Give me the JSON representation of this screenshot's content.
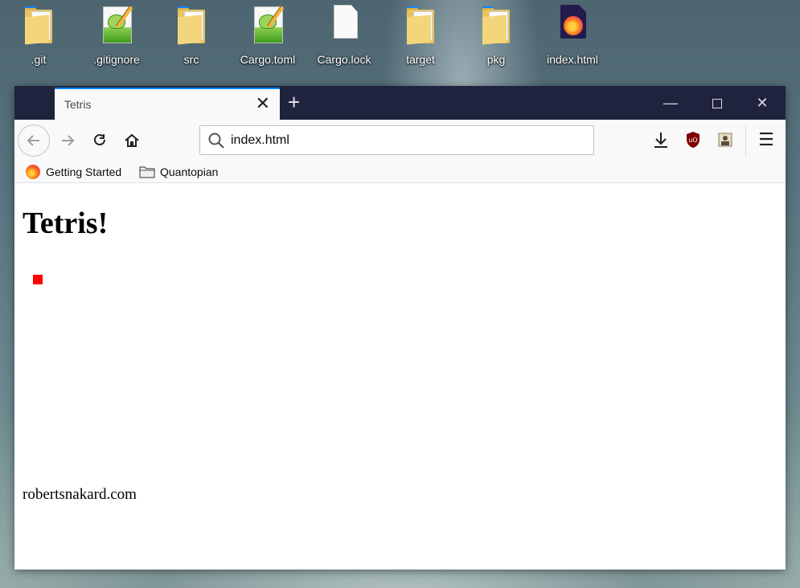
{
  "desktop": {
    "items": [
      {
        "label": ".git",
        "icon": "folder-icon"
      },
      {
        "label": ".gitignore",
        "icon": "notepadpp-file-icon"
      },
      {
        "label": "src",
        "icon": "folder-icon"
      },
      {
        "label": "Cargo.toml",
        "icon": "notepadpp-file-icon"
      },
      {
        "label": "Cargo.lock",
        "icon": "blank-file-icon"
      },
      {
        "label": "target",
        "icon": "folder-icon"
      },
      {
        "label": "pkg",
        "icon": "folder-icon"
      },
      {
        "label": "index.html",
        "icon": "firefox-html-file-icon"
      }
    ]
  },
  "browser": {
    "tab": {
      "title": "Tetris"
    },
    "url": "index.html",
    "bookmarks": [
      {
        "label": "Getting Started"
      },
      {
        "label": "Quantopian"
      }
    ],
    "colors": {
      "titlebar": "#20233d",
      "tab_accent": "#0a84ff",
      "toolbar": "#f9f9fa"
    }
  },
  "page": {
    "heading": "Tetris!",
    "block_color": "#ff0000",
    "footer": "robertsnakard.com"
  }
}
